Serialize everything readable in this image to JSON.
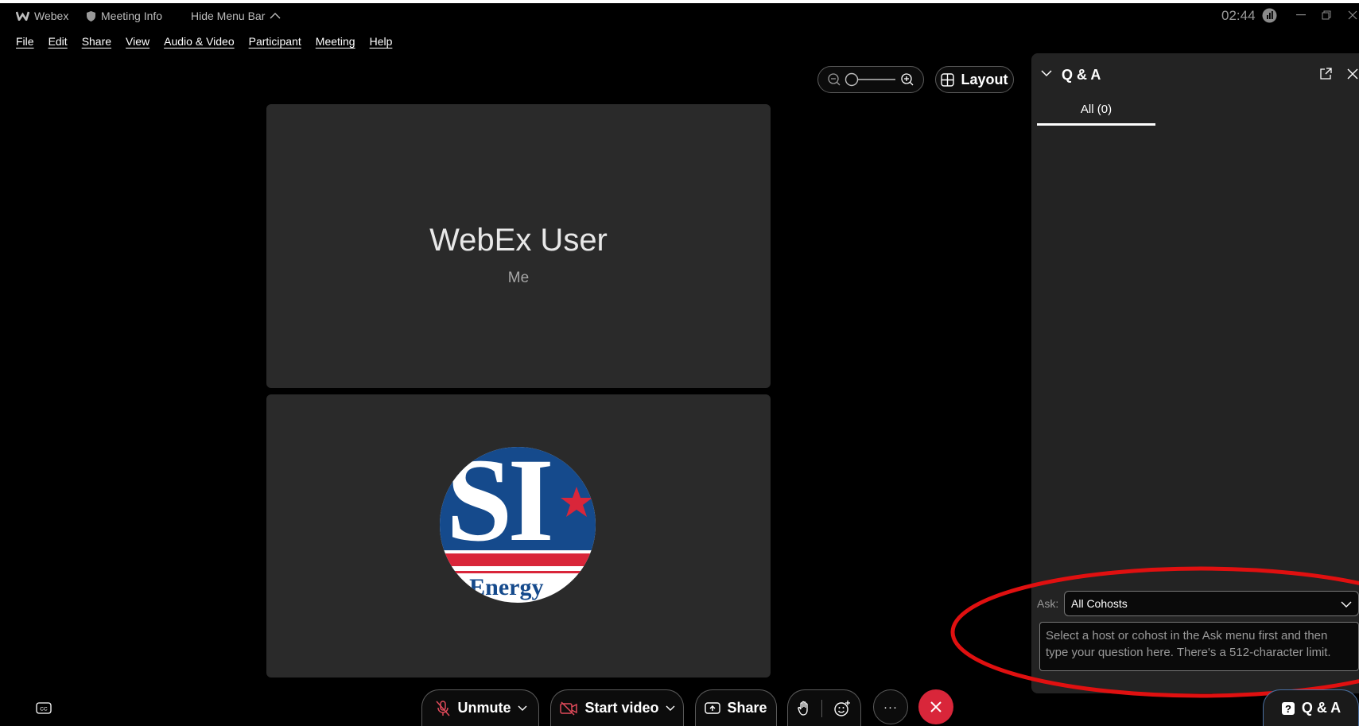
{
  "titlebar": {
    "app_name": "Webex",
    "meeting_info": "Meeting Info",
    "hide_menu_bar": "Hide Menu Bar",
    "time": "02:44"
  },
  "menu": [
    "File",
    "Edit",
    "Share",
    "View",
    "Audio & Video",
    "Participant",
    "Meeting",
    "Help"
  ],
  "view_controls": {
    "layout_label": "Layout"
  },
  "tiles": {
    "self_name": "WebEx User",
    "self_label": "Me",
    "avatar_text": "s Energy"
  },
  "qa_panel": {
    "title": "Q & A",
    "tab_all": "All (0)",
    "ask_label": "Ask:",
    "ask_selected": "All Cohosts",
    "question_placeholder": "Select a host or cohost in the Ask menu first and then type your question here. There's a 512-character limit."
  },
  "controls": {
    "unmute": "Unmute",
    "start_video": "Start video",
    "share": "Share",
    "more": "···",
    "qa_button": "Q & A"
  },
  "colors": {
    "accent_red": "#d9263a",
    "annotation_red": "#e01010",
    "tile_bg": "#2a2a2a"
  }
}
